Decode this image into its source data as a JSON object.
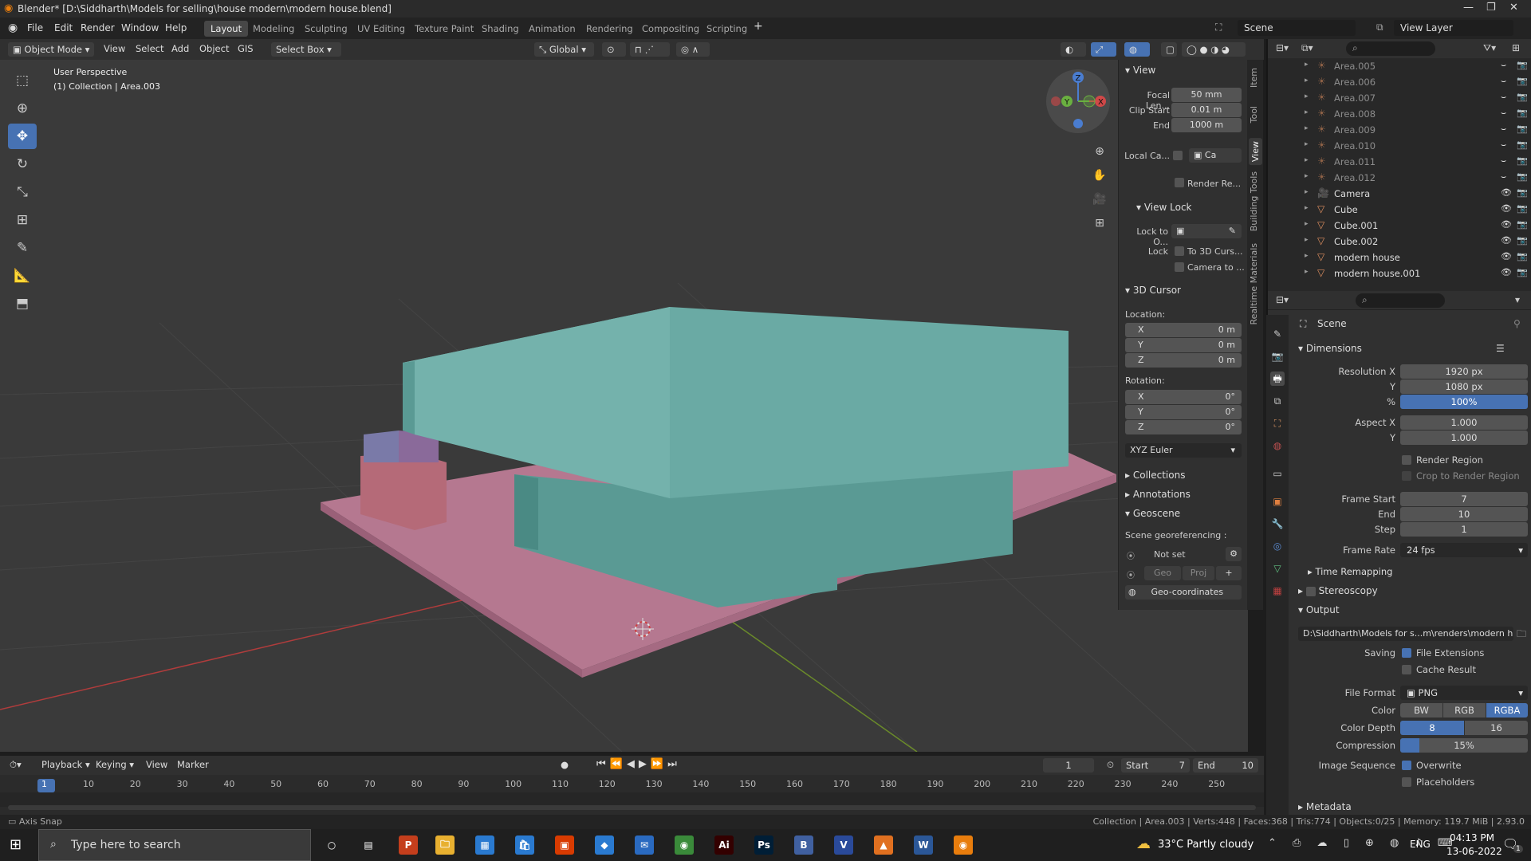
{
  "window": {
    "title": "Blender* [D:\\Siddharth\\Models for selling\\house modern\\modern house.blend]",
    "minimize": "—",
    "restore": "❐",
    "close": "✕"
  },
  "menu": {
    "items": [
      "File",
      "Edit",
      "Render",
      "Window",
      "Help"
    ]
  },
  "workspaces": {
    "tabs": [
      "Layout",
      "Modeling",
      "Sculpting",
      "UV Editing",
      "Texture Paint",
      "Shading",
      "Animation",
      "Rendering",
      "Compositing",
      "Scripting"
    ],
    "active": "Layout",
    "add": "+"
  },
  "scene": {
    "label": "Scene",
    "view_layer": "View Layer"
  },
  "header": {
    "mode": "Object Mode",
    "view": "View",
    "select": "Select",
    "add": "Add",
    "object": "Object",
    "gis": "GIS",
    "select_box": "Select Box",
    "orientation": "Global"
  },
  "viewport": {
    "perspective": "User Perspective",
    "collection_info": "(1) Collection | Area.003"
  },
  "gizmo": {
    "x": "X",
    "y": "Y",
    "z": "Z"
  },
  "npanel": {
    "tabs": [
      "Item",
      "Tool",
      "View",
      "Building Tools",
      "Realtime Materials"
    ],
    "active_tab": "View",
    "view_header": "View",
    "focal_label": "Focal Len...",
    "focal_value": "50 mm",
    "clip_start_label": "Clip Start",
    "clip_start_value": "0.01 m",
    "clip_end_label": "End",
    "clip_end_value": "1000 m",
    "local_camera_label": "Local Ca...",
    "local_camera_value": "Ca",
    "render_region_label": "Render Re...",
    "view_lock_header": "View Lock",
    "lock_to_object_label": "Lock to O...",
    "lock_label": "Lock",
    "lock_to_cursor": "To 3D Curs...",
    "camera_to_view": "Camera to ...",
    "cursor_header": "3D Cursor",
    "location_label": "Location:",
    "loc": [
      {
        "axis": "X",
        "value": "0 m"
      },
      {
        "axis": "Y",
        "value": "0 m"
      },
      {
        "axis": "Z",
        "value": "0 m"
      }
    ],
    "rotation_label": "Rotation:",
    "rot": [
      {
        "axis": "X",
        "value": "0°"
      },
      {
        "axis": "Y",
        "value": "0°"
      },
      {
        "axis": "Z",
        "value": "0°"
      }
    ],
    "rotation_mode": "XYZ Euler",
    "collections": "Collections",
    "annotations": "Annotations",
    "geoscene": "Geoscene",
    "georef_label": "Scene georeferencing :",
    "not_set": "Not set",
    "geo": "Geo",
    "proj": "Proj",
    "geo_coords": "Geo-coordinates"
  },
  "outliner": {
    "rows": [
      {
        "name": "Area.005",
        "dim": true,
        "icon": "light-icon"
      },
      {
        "name": "Area.006",
        "dim": true,
        "icon": "light-icon"
      },
      {
        "name": "Area.007",
        "dim": true,
        "icon": "light-icon"
      },
      {
        "name": "Area.008",
        "dim": true,
        "icon": "light-icon"
      },
      {
        "name": "Area.009",
        "dim": true,
        "icon": "light-icon"
      },
      {
        "name": "Area.010",
        "dim": true,
        "icon": "light-icon"
      },
      {
        "name": "Area.011",
        "dim": true,
        "icon": "light-icon"
      },
      {
        "name": "Area.012",
        "dim": true,
        "icon": "light-icon"
      },
      {
        "name": "Camera",
        "dim": false,
        "icon": "camera-icon"
      },
      {
        "name": "Cube",
        "dim": false,
        "icon": "mesh-icon"
      },
      {
        "name": "Cube.001",
        "dim": false,
        "icon": "mesh-icon"
      },
      {
        "name": "Cube.002",
        "dim": false,
        "icon": "mesh-icon"
      },
      {
        "name": "modern house",
        "dim": false,
        "icon": "mesh-icon"
      },
      {
        "name": "modern house.001",
        "dim": false,
        "icon": "mesh-icon"
      }
    ]
  },
  "properties": {
    "scene_label": "Scene",
    "dimensions": "Dimensions",
    "res_x_label": "Resolution X",
    "res_x": "1920 px",
    "res_y_label": "Y",
    "res_y": "1080 px",
    "res_pct_label": "%",
    "res_pct": "100%",
    "aspect_x_label": "Aspect X",
    "aspect_x": "1.000",
    "aspect_y_label": "Y",
    "aspect_y": "1.000",
    "render_region": "Render Region",
    "crop": "Crop to Render Region",
    "frame_start_label": "Frame Start",
    "frame_start": "7",
    "frame_end_label": "End",
    "frame_end": "10",
    "frame_step_label": "Step",
    "frame_step": "1",
    "frame_rate_label": "Frame Rate",
    "frame_rate": "24 fps",
    "time_remap": "Time Remapping",
    "stereoscopy": "Stereoscopy",
    "output": "Output",
    "output_path": "D:\\Siddharth\\Models for s...m\\renders\\modern house",
    "saving_label": "Saving",
    "file_ext": "File Extensions",
    "cache": "Cache Result",
    "file_format_label": "File Format",
    "file_format": "PNG",
    "color_label": "Color",
    "color_opts": [
      "BW",
      "RGB",
      "RGBA"
    ],
    "color_active": "RGBA",
    "depth_label": "Color Depth",
    "depth_opts": [
      "8",
      "16"
    ],
    "compression_label": "Compression",
    "compression": "15%",
    "compression_level": 0.15,
    "image_seq_label": "Image Sequence",
    "overwrite": "Overwrite",
    "placeholders": "Placeholders",
    "metadata": "Metadata"
  },
  "timeline": {
    "playback": "Playback",
    "keying": "Keying",
    "view": "View",
    "marker": "Marker",
    "current_frame": "1",
    "start_label": "Start",
    "start": "7",
    "end_label": "End",
    "end": "10",
    "ticks": [
      "1",
      "10",
      "20",
      "30",
      "40",
      "50",
      "60",
      "70",
      "80",
      "90",
      "100",
      "110",
      "120",
      "130",
      "140",
      "150",
      "160",
      "170",
      "180",
      "190",
      "200",
      "210",
      "220",
      "230",
      "240",
      "250"
    ]
  },
  "status": {
    "left": "Axis Snap",
    "right": "Collection | Area.003 | Verts:448 | Faces:368 | Tris:774 | Objects:0/25 | Memory: 119.7 MiB | 2.93.0"
  },
  "taskbar": {
    "search_placeholder": "Type here to search",
    "weather": "33°C  Partly cloudy",
    "lang": "ENG",
    "time": "04:13 PM",
    "date": "13-06-2022",
    "notif": "1",
    "apps": [
      "task-view",
      "explorer-p",
      "file-explorer",
      "store-app",
      "ms-store",
      "office",
      "vscode-like",
      "thunderbird",
      "chrome",
      "illustrator",
      "photoshop",
      "blender-b",
      "vivaldi",
      "vlc",
      "word",
      "blender"
    ]
  }
}
